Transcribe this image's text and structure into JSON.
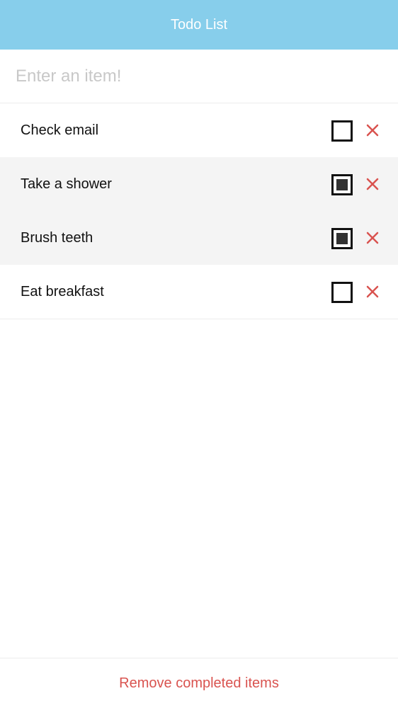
{
  "header": {
    "title": "Todo List",
    "background_color": "#87ceeb"
  },
  "new_item": {
    "value": "",
    "placeholder": "Enter an item!"
  },
  "todos": [
    {
      "text": "Check email",
      "completed": false
    },
    {
      "text": "Take a shower",
      "completed": true
    },
    {
      "text": "Brush teeth",
      "completed": true
    },
    {
      "text": "Eat breakfast",
      "completed": false
    }
  ],
  "icons": {
    "delete": "close-icon",
    "checkbox": "checkbox-icon"
  },
  "colors": {
    "accent_red": "#d9534f",
    "completed_row": "#f4f4f4"
  },
  "footer": {
    "remove_completed_label": "Remove completed items"
  }
}
